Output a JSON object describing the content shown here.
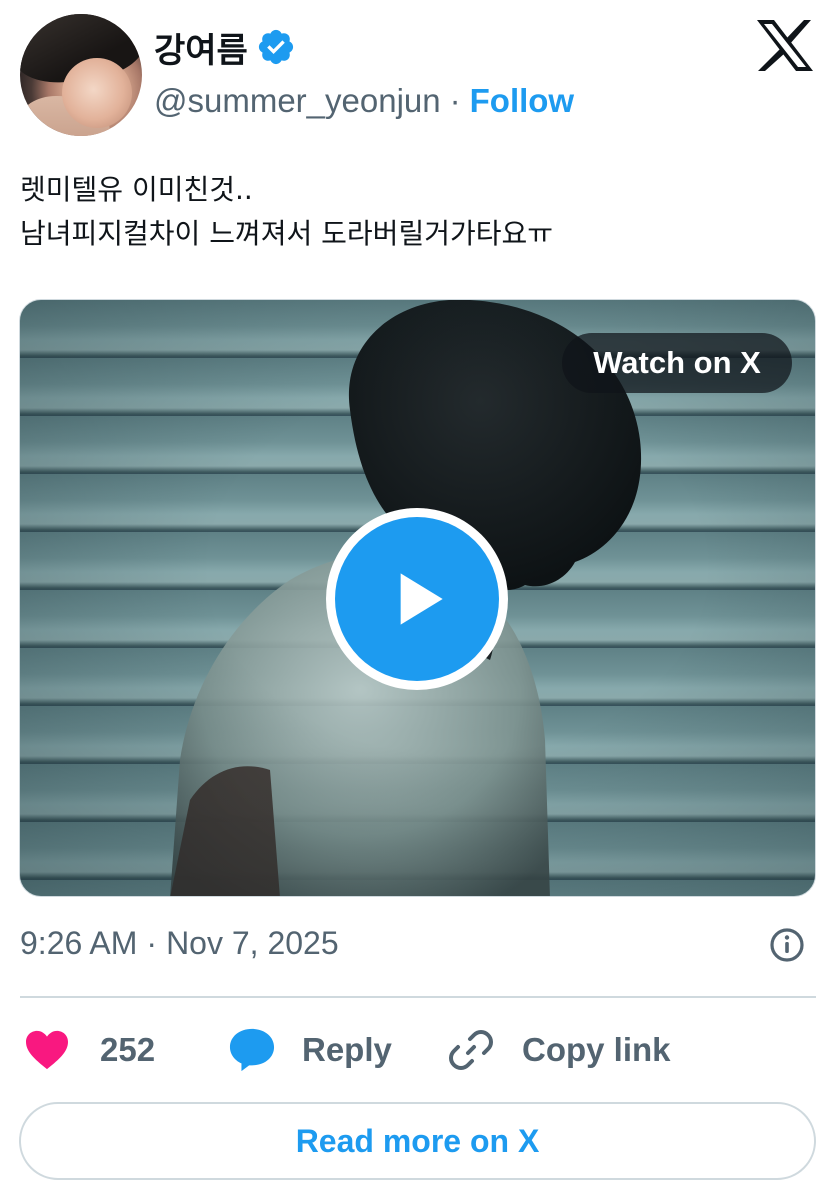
{
  "author": {
    "display_name": "강여름",
    "handle": "@summer_yeonjun",
    "separator": "·",
    "follow_label": "Follow",
    "verified": true
  },
  "brand": {
    "logo": "x-logo-icon"
  },
  "tweet": {
    "lines": [
      "렛미텔유 이미친것..",
      "남녀피지컬차이 느껴져서 도라버릴거가타요ㅠ"
    ]
  },
  "media": {
    "type": "video",
    "watch_label": "Watch on X",
    "play_icon": "play-icon"
  },
  "meta": {
    "time": "9:26 AM",
    "separator": "·",
    "date": "Nov 7, 2025",
    "info_icon": "info-icon"
  },
  "actions": {
    "like_count": "252",
    "reply_label": "Reply",
    "copy_label": "Copy link"
  },
  "footer": {
    "read_more_label": "Read more on X"
  },
  "colors": {
    "accent": "#1d9bf0",
    "like": "#f91880",
    "text": "#0f1419",
    "muted": "#536471",
    "border": "#cfd9de"
  }
}
